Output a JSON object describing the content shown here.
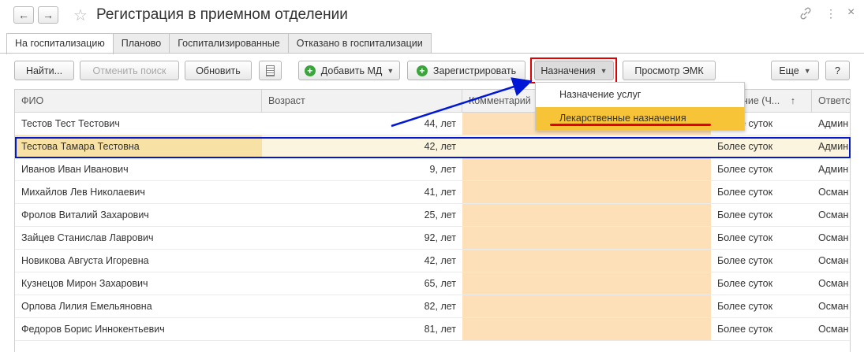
{
  "window": {
    "title": "Регистрация в приемном отделении",
    "back_icon": "←",
    "forward_icon": "→",
    "star_icon": "☆",
    "link_icon": "🔗",
    "more_icon": "⋮",
    "close_icon": "×"
  },
  "tabs": [
    {
      "label": "На госпитализацию",
      "active": true
    },
    {
      "label": "Планово",
      "active": false
    },
    {
      "label": "Госпитализированные",
      "active": false
    },
    {
      "label": "Отказано в госпитализации",
      "active": false
    }
  ],
  "toolbar": {
    "find": "Найти...",
    "cancel_search": "Отменить поиск",
    "refresh": "Обновить",
    "add_md": "Добавить МД",
    "register": "Зарегистрировать",
    "assignments": "Назначения",
    "view_emk": "Просмотр ЭМК",
    "more": "Еще",
    "help": "?"
  },
  "table": {
    "columns": [
      "ФИО",
      "Возраст",
      "Комментарий",
      "ние (Ч...",
      "Ответс"
    ],
    "sort_icon": "↑",
    "rows": [
      {
        "name": "Тестов Тест Тестович",
        "age": "44, лет",
        "stay": "Более суток",
        "resp": "Админ"
      },
      {
        "name": "Тестова Тамара Тестовна",
        "age": "42, лет",
        "stay": "Более суток",
        "resp": "Админ"
      },
      {
        "name": "Иванов Иван Иванович",
        "age": "9, лет",
        "stay": "Более суток",
        "resp": "Админ"
      },
      {
        "name": "Михайлов Лев Николаевич",
        "age": "41, лет",
        "stay": "Более суток",
        "resp": "Осман"
      },
      {
        "name": "Фролов Виталий Захарович",
        "age": "25, лет",
        "stay": "Более суток",
        "resp": "Осман"
      },
      {
        "name": "Зайцев Станислав Лаврович",
        "age": "92, лет",
        "stay": "Более суток",
        "resp": "Осман"
      },
      {
        "name": "Новикова Августа Игоревна",
        "age": "42, лет",
        "stay": "Более суток",
        "resp": "Осман"
      },
      {
        "name": "Кузнецов Мирон Захарович",
        "age": "65, лет",
        "stay": "Более суток",
        "resp": "Осман"
      },
      {
        "name": "Орлова Лилия Емельяновна",
        "age": "82, лет",
        "stay": "Более суток",
        "resp": "Осман"
      },
      {
        "name": "Федоров Борис Иннокентьевич",
        "age": "81, лет",
        "stay": "Более суток",
        "resp": "Осман"
      }
    ]
  },
  "dropdown": {
    "items": [
      "Назначение услуг",
      "Лекарственные назначения"
    ]
  },
  "colors": {
    "annotation_red": "#e30000",
    "annotation_blue": "#0018d6",
    "highlight_yellow": "#f7c437",
    "comment_bg": "#fde0b7"
  }
}
